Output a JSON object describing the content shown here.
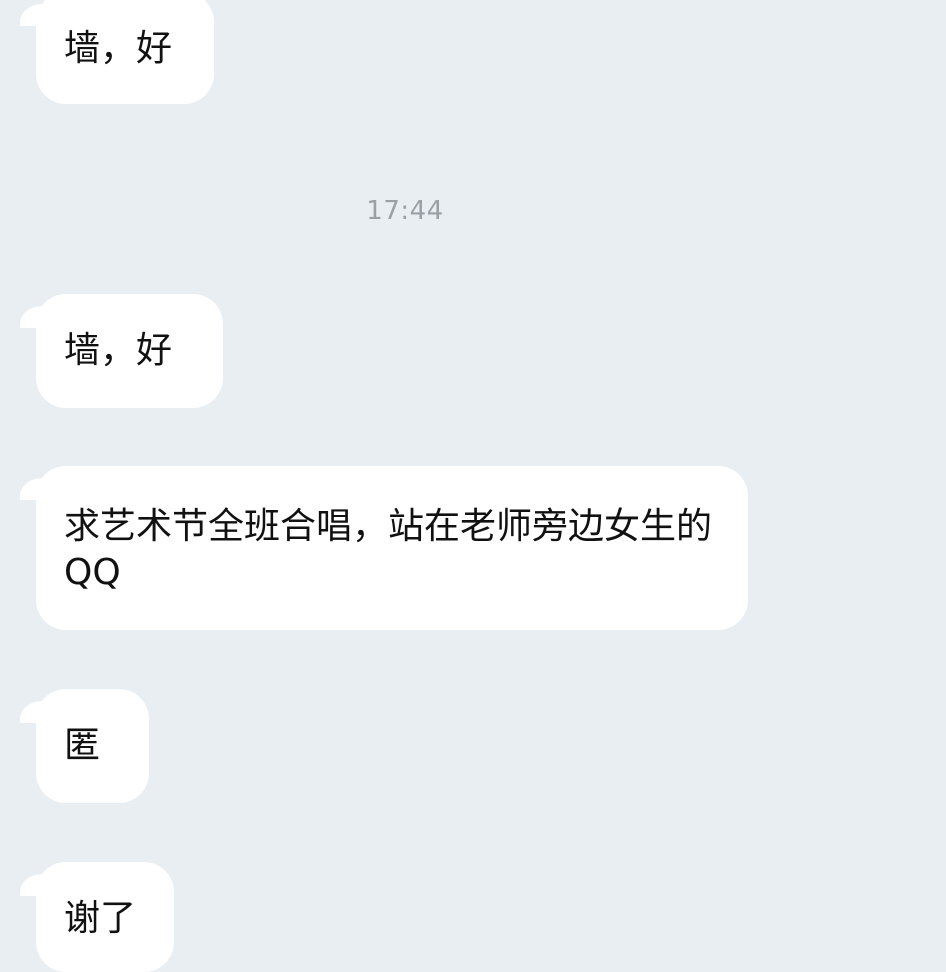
{
  "conversation": {
    "timestamp": "17:44",
    "messages": [
      {
        "text": "墙，好"
      },
      {
        "text": "墙，好"
      },
      {
        "text": "求艺术节全班合唱，站在老师旁边女生的QQ"
      },
      {
        "text": "匿"
      },
      {
        "text": "谢了"
      }
    ]
  },
  "colors": {
    "background": "#e9eef2",
    "bubble": "#ffffff",
    "text": "#111111",
    "timestamp": "#9aa0a6"
  }
}
